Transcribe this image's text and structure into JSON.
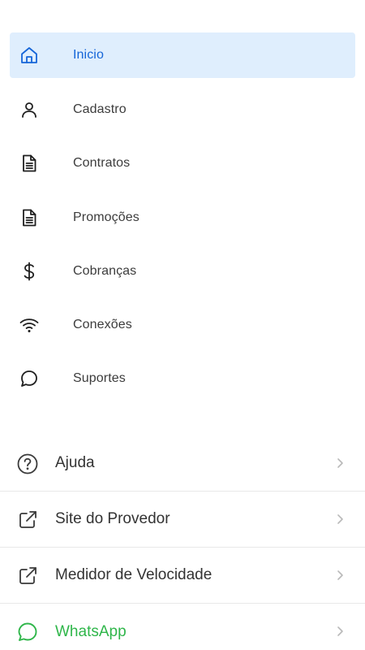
{
  "colors": {
    "accent": "#1565d8",
    "active_bg": "#dfeefd",
    "whatsapp": "#2fb64a",
    "text": "#3c3c3c",
    "chevron": "#b9b9b9"
  },
  "nav": {
    "items": [
      {
        "label": "Inicio",
        "icon": "home-icon",
        "active": true
      },
      {
        "label": "Cadastro",
        "icon": "user-icon"
      },
      {
        "label": "Contratos",
        "icon": "document-icon"
      },
      {
        "label": "Promoções",
        "icon": "document-icon"
      },
      {
        "label": "Cobranças",
        "icon": "dollar-icon"
      },
      {
        "label": "Conexões",
        "icon": "wifi-icon"
      },
      {
        "label": "Suportes",
        "icon": "chat-icon"
      }
    ]
  },
  "list": {
    "items": [
      {
        "label": "Ajuda",
        "icon": "help-circle-icon"
      },
      {
        "label": "Site do Provedor",
        "icon": "external-link-icon"
      },
      {
        "label": "Medidor de Velocidade",
        "icon": "external-link-icon"
      },
      {
        "label": "WhatsApp",
        "icon": "whatsapp-icon"
      }
    ]
  }
}
